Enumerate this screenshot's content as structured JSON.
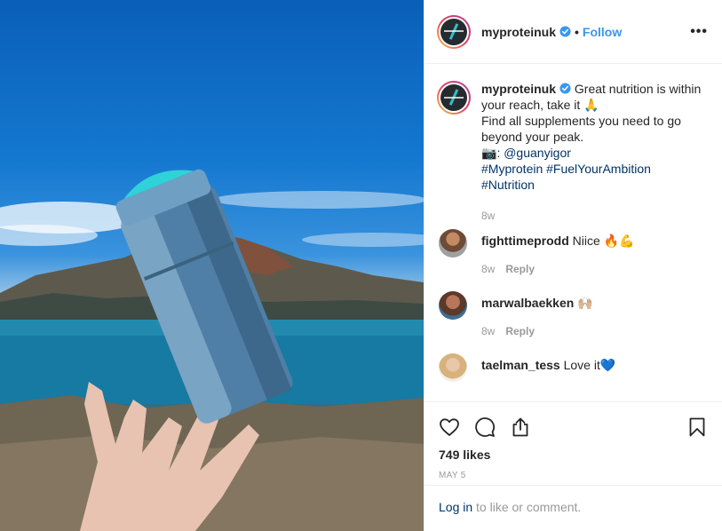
{
  "post": {
    "username": "myproteinuk",
    "follow_label": "Follow",
    "dot": "•",
    "more_label": "•••"
  },
  "caption": {
    "username": "myproteinuk",
    "line1": "Great nutrition is within your reach, take it",
    "emoji1": "🙏",
    "line2": "Find all supplements you need to go beyond your peak.",
    "camera_emoji": "📷",
    "credit_prefix": ": ",
    "credit": "@guanyigor",
    "tags_line1": "#Myprotein #FuelYourAmbition",
    "tags_line2": "#Nutrition",
    "time": "8w"
  },
  "comments": [
    {
      "username": "fighttimeprodd",
      "text": "Niice",
      "emoji": "🔥💪",
      "time": "8w",
      "reply_label": "Reply"
    },
    {
      "username": "marwalbaekken",
      "text": "",
      "emoji": "🙌🏼",
      "time": "8w",
      "reply_label": "Reply"
    },
    {
      "username": "taelman_tess",
      "text": "Love it",
      "emoji": "💙"
    }
  ],
  "actions": {
    "likes": "749 likes",
    "date": "MAY 5"
  },
  "login": {
    "link": "Log in",
    "rest": " to like or comment."
  },
  "icons": {
    "verified": "verified-badge-icon",
    "like": "heart-icon",
    "comment": "comment-bubble-icon",
    "share": "share-icon",
    "save": "bookmark-icon",
    "more": "more-options-icon"
  },
  "colors": {
    "link_blue": "#3897f0",
    "hashtag": "#003569",
    "muted": "#999999",
    "text": "#262626"
  }
}
